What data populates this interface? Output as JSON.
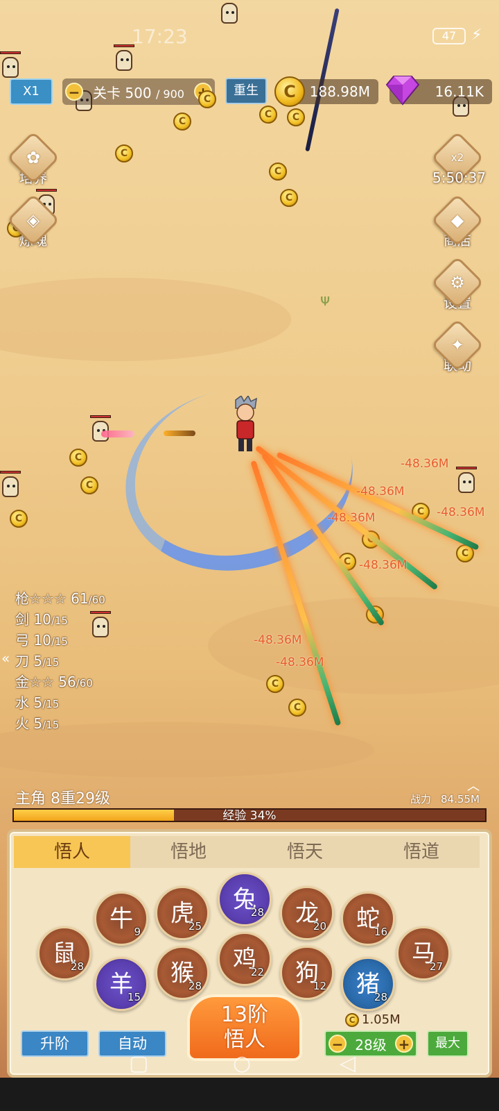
{
  "status": {
    "time": "17:23",
    "battery": "47"
  },
  "topbar": {
    "speed": "X1",
    "stage_label": "关卡",
    "stage_current": "500",
    "stage_total": "/ 900",
    "minus": "−",
    "plus": "+",
    "rebirth": "重生",
    "gold": "188.98M",
    "gems": "16.11K"
  },
  "left_menu": [
    {
      "label": "培养",
      "icon": "cultivate-icon"
    },
    {
      "label": "炼魂",
      "icon": "soul-icon"
    }
  ],
  "right_menu": {
    "bonus": "x2",
    "timer": "5:50:37",
    "items": [
      {
        "label": "商店",
        "icon": "shop-icon"
      },
      {
        "label": "设置",
        "icon": "gear-icon"
      },
      {
        "label": "联动",
        "icon": "link-icon"
      }
    ]
  },
  "damage_numbers": [
    "-48.36M",
    "-48.36M",
    "-48.36M",
    "-48.36M",
    "-48.36M",
    "-48.36M",
    "-48.36M",
    "-48.36M"
  ],
  "weapons": [
    {
      "name": "枪☆☆☆ 61",
      "max": "/60"
    },
    {
      "name": "剑 10",
      "max": "/15"
    },
    {
      "name": "弓 10",
      "max": "/15"
    },
    {
      "name": "刀 5",
      "max": "/15"
    },
    {
      "name": "金☆☆ 56",
      "max": "/60"
    },
    {
      "name": "水 5",
      "max": "/15"
    },
    {
      "name": "火 5",
      "max": "/15"
    }
  ],
  "hero": {
    "level": "主角 8重29级",
    "power_label": "战力",
    "power_value": "84.55M",
    "xp_text": "经验 34%",
    "xp_percent": 34
  },
  "tabs": [
    "悟人",
    "悟地",
    "悟天",
    "悟道"
  ],
  "zodiac": [
    {
      "animal": "鼠",
      "level": "28",
      "style": "brown"
    },
    {
      "animal": "牛",
      "level": "9",
      "style": "brown"
    },
    {
      "animal": "虎",
      "level": "25",
      "style": "brown"
    },
    {
      "animal": "兔",
      "level": "28",
      "style": "purple"
    },
    {
      "animal": "龙",
      "level": "20",
      "style": "brown"
    },
    {
      "animal": "蛇",
      "level": "16",
      "style": "brown"
    },
    {
      "animal": "马",
      "level": "27",
      "style": "brown"
    },
    {
      "animal": "羊",
      "level": "15",
      "style": "purple"
    },
    {
      "animal": "猴",
      "level": "28",
      "style": "brown"
    },
    {
      "animal": "鸡",
      "level": "22",
      "style": "brown"
    },
    {
      "animal": "狗",
      "level": "12",
      "style": "brown"
    },
    {
      "animal": "猪",
      "level": "28",
      "style": "blue"
    }
  ],
  "actions": {
    "upgrade": "升阶",
    "auto": "自动",
    "main_line1": "13阶",
    "main_line2": "悟人",
    "cost": "1.05M",
    "level": "28级",
    "max": "最大"
  },
  "colors": {
    "accent": "#f7c655",
    "danger": "#e85a2a",
    "button_blue": "#3b86c4",
    "button_green": "#4caa3c"
  }
}
